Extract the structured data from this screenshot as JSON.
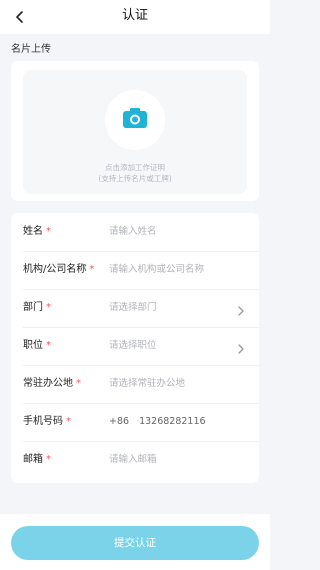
{
  "header": {
    "title": "认证",
    "back_icon": "chevron-left-icon"
  },
  "upload": {
    "section_label": "名片上传",
    "icon": "camera-icon",
    "hint_line1": "点击添加工作证明",
    "hint_line2": "(支持上传名片或工牌)",
    "accent": "#1fb3d6"
  },
  "form": {
    "fields": [
      {
        "label": "姓名",
        "required_mark": "*",
        "placeholder": "请输入姓名",
        "value": "",
        "chevron": false
      },
      {
        "label": "机构/公司名称",
        "required_mark": "*",
        "placeholder": "请输入机构或公司名称",
        "value": "",
        "chevron": false
      },
      {
        "label": "部门",
        "required_mark": "*",
        "placeholder": "请选择部门",
        "value": "",
        "chevron": true
      },
      {
        "label": "职位",
        "required_mark": "*",
        "placeholder": "请选择职位",
        "value": "",
        "chevron": true
      },
      {
        "label": "常驻办公地",
        "required_mark": "*",
        "placeholder": "请选择常驻办公地",
        "value": "",
        "chevron": false
      },
      {
        "label": "手机号码",
        "required_mark": "*",
        "country_code": "+86",
        "placeholder": "",
        "value": "13268282116",
        "chevron": false
      },
      {
        "label": "邮箱",
        "required_mark": "*",
        "placeholder": "请输入邮箱",
        "value": "",
        "chevron": false
      }
    ]
  },
  "submit": {
    "label": "提交认证",
    "color": "#7ad3e8"
  }
}
